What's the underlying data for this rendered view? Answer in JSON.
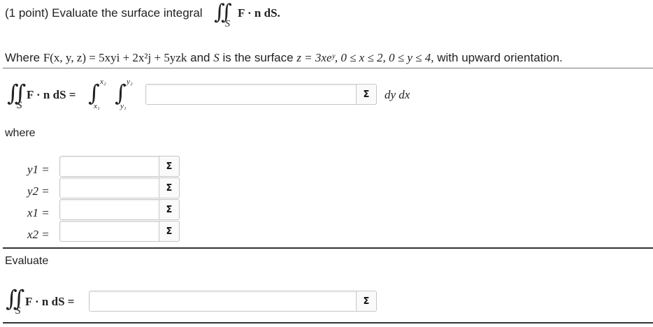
{
  "problem": {
    "points": "(1 point)",
    "instruction": "Evaluate the surface integral",
    "integrand": "F · n dS.",
    "where_prefix": "Where",
    "field_lhs": "F(x, y, z) = ",
    "field_rhs": "5xyi + 2x²j + 5yzk",
    "and_text": "and",
    "S_text": "S",
    "is_surface_text": "is the surface",
    "surface_eq": "z = 3xeʸ, 0 ≤ x ≤ 2, 0 ≤ y ≤ 4,",
    "orientation": "with upward orientation."
  },
  "integral_setup": {
    "lhs": "F · n dS =",
    "x_upper": "x₂",
    "x_lower": "x₁",
    "y_upper": "y₂",
    "y_lower": "y₁",
    "integrand_value": "",
    "differentials": "dy dx"
  },
  "where_label": "where",
  "limits": [
    {
      "label": "y1 =",
      "value": ""
    },
    {
      "label": "y2 =",
      "value": ""
    },
    {
      "label": "x1 =",
      "value": ""
    },
    {
      "label": "x2 =",
      "value": ""
    }
  ],
  "evaluate_label": "Evaluate",
  "final": {
    "lhs": "F · n dS =",
    "value": ""
  },
  "sigma_label": "Σ",
  "surface_subscript": "S"
}
